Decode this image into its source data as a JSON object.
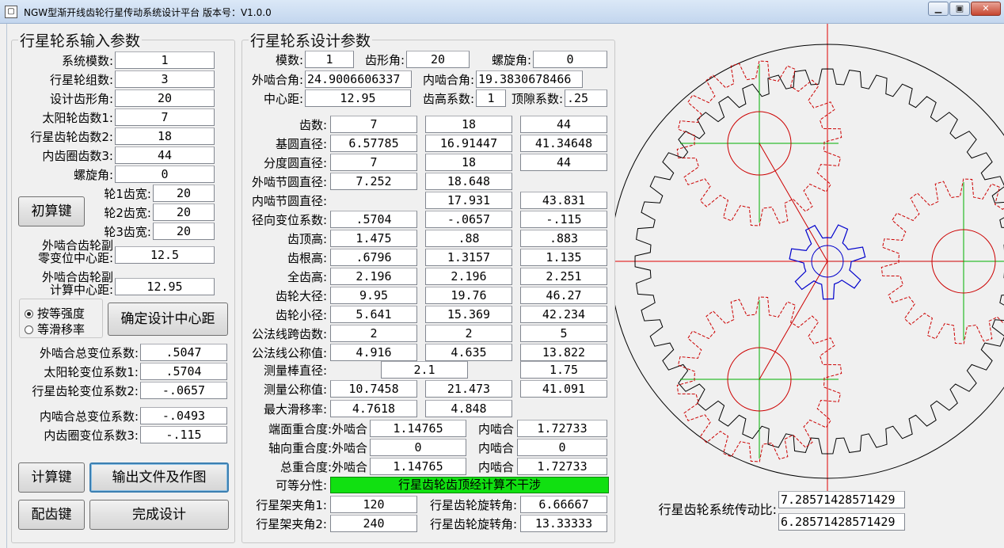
{
  "window": {
    "title": "NGW型渐开线齿轮行星传动系统设计平台 版本号：V1.0.0",
    "icon": "app-icon",
    "controls": [
      "minimize-icon",
      "maximize-icon",
      "close-icon"
    ]
  },
  "input": {
    "title": "行星轮系输入参数",
    "module_label": "系统模数:",
    "module": "1",
    "planet_count_label": "行星轮组数:",
    "planet_count": "3",
    "pressure_angle_label": "设计齿形角:",
    "pressure_angle": "20",
    "sun_teeth_label": "太阳轮齿数1:",
    "sun_teeth": "7",
    "planet_teeth_label": "行星齿轮齿数2:",
    "planet_teeth": "18",
    "ring_teeth_label": "内齿圈齿数3:",
    "ring_teeth": "44",
    "helix_label": "螺旋角:",
    "helix": "0",
    "init_button": "初算键",
    "w1_label": "轮1齿宽:",
    "w1": "20",
    "w2_label": "轮2齿宽:",
    "w2": "20",
    "w3_label": "轮3齿宽:",
    "w3": "20",
    "zero_cd_label1": "外啮合齿轮副",
    "zero_cd_label2": "零变位中心距:",
    "zero_cd": "12.5",
    "calc_cd_label1": "外啮合齿轮副",
    "calc_cd_label2": "计算中心距:",
    "calc_cd": "12.95",
    "radio_equal_strength": "按等强度",
    "radio_equal_slip": "等滑移率",
    "confirm_cd_button": "确定设计中心距",
    "ext_total_shift_label": "外啮合总变位系数:",
    "ext_total_shift": ".5047",
    "sun_shift_label": "太阳轮变位系数1:",
    "sun_shift": ".5704",
    "planet_shift_label": "行星齿轮变位系数2:",
    "planet_shift": "-.0657",
    "int_total_shift_label": "内啮合总变位系数:",
    "int_total_shift": "-.0493",
    "ring_shift_label": "内齿圈变位系数3:",
    "ring_shift": "-.115",
    "calc_button": "计算键",
    "output_button": "输出文件及作图",
    "match_button": "配齿键",
    "finish_button": "完成设计"
  },
  "design": {
    "title": "行星轮系设计参数",
    "module_label": "模数:",
    "module": "1",
    "profile_label": "齿形角:",
    "profile": "20",
    "helix_label": "螺旋角:",
    "helix": "0",
    "ext_angle_label": "外啮合角:",
    "ext_angle": "24.9006606337",
    "int_angle_label": "内啮合角:",
    "int_angle": "19.3830678466",
    "cd_label": "中心距:",
    "cd": "12.95",
    "addendum_coef_label": "齿高系数:",
    "addendum_coef": "1",
    "clearance_label": "顶隙系数:",
    "clearance": ".25",
    "rows": [
      {
        "label": "齿数:",
        "v": [
          "7",
          "18",
          "44"
        ]
      },
      {
        "label": "基圆直径:",
        "v": [
          "6.57785",
          "16.91447",
          "41.34648"
        ]
      },
      {
        "label": "分度圆直径:",
        "v": [
          "7",
          "18",
          "44"
        ]
      },
      {
        "label": "外啮节圆直径:",
        "v": [
          "7.252",
          "18.648",
          ""
        ]
      },
      {
        "label": "内啮节圆直径:",
        "v": [
          "",
          "17.931",
          "43.831"
        ]
      },
      {
        "label": "径向变位系数:",
        "v": [
          ".5704",
          "-.0657",
          "-.115"
        ]
      },
      {
        "label": "齿顶高:",
        "v": [
          "1.475",
          ".88",
          ".883"
        ]
      },
      {
        "label": "齿根高:",
        "v": [
          ".6796",
          "1.3157",
          "1.135"
        ]
      },
      {
        "label": "全齿高:",
        "v": [
          "2.196",
          "2.196",
          "2.251"
        ]
      },
      {
        "label": "齿轮大径:",
        "v": [
          "9.95",
          "19.76",
          "46.27"
        ]
      },
      {
        "label": "齿轮小径:",
        "v": [
          "5.641",
          "15.369",
          "42.234"
        ]
      },
      {
        "label": "公法线跨齿数:",
        "v": [
          "2",
          "2",
          "5"
        ]
      },
      {
        "label": "公法线公称值:",
        "v": [
          "4.916",
          "4.635",
          "13.822"
        ]
      }
    ],
    "pin_label": "测量棒直径:",
    "pin_ext": "2.1",
    "pin_int": "1.75",
    "meas_label": "测量公称值:",
    "meas": [
      "10.7458",
      "21.473",
      "41.091"
    ],
    "slip_label": "最大滑移率:",
    "slip": [
      "4.7618",
      "4.848"
    ],
    "tcr_label": "端面重合度:外啮合",
    "tcr_ext": "1.14765",
    "int_label": "内啮合",
    "tcr_int": "1.72733",
    "acr_label": "轴向重合度:外啮合",
    "acr_ext": "0",
    "acr_int": "0",
    "ocr_label": "总重合度:外啮合",
    "ocr_ext": "1.14765",
    "ocr_int": "1.72733",
    "assembly_label": "可等分性:",
    "assembly_status": "行星齿轮齿顶经计算不干涉",
    "status_color": "#11e011",
    "carrier1_label": "行星架夹角1:",
    "carrier1": "120",
    "carrier2_label": "行星架夹角2:",
    "carrier2": "240",
    "rot1_label": "行星齿轮旋转角:",
    "rot1": "6.66667",
    "rot2_label": "行星齿轮旋转角:",
    "rot2": "13.33333"
  },
  "ratio": {
    "label": "行星齿轮系统传动比:",
    "v1": "7.28571428571429",
    "v2": "6.28571428571429"
  },
  "colors": {
    "axis": "#e00000",
    "sun": "#0000cc",
    "planet": "#cc0000",
    "ring": "#000000",
    "centerline": "#00b000"
  }
}
